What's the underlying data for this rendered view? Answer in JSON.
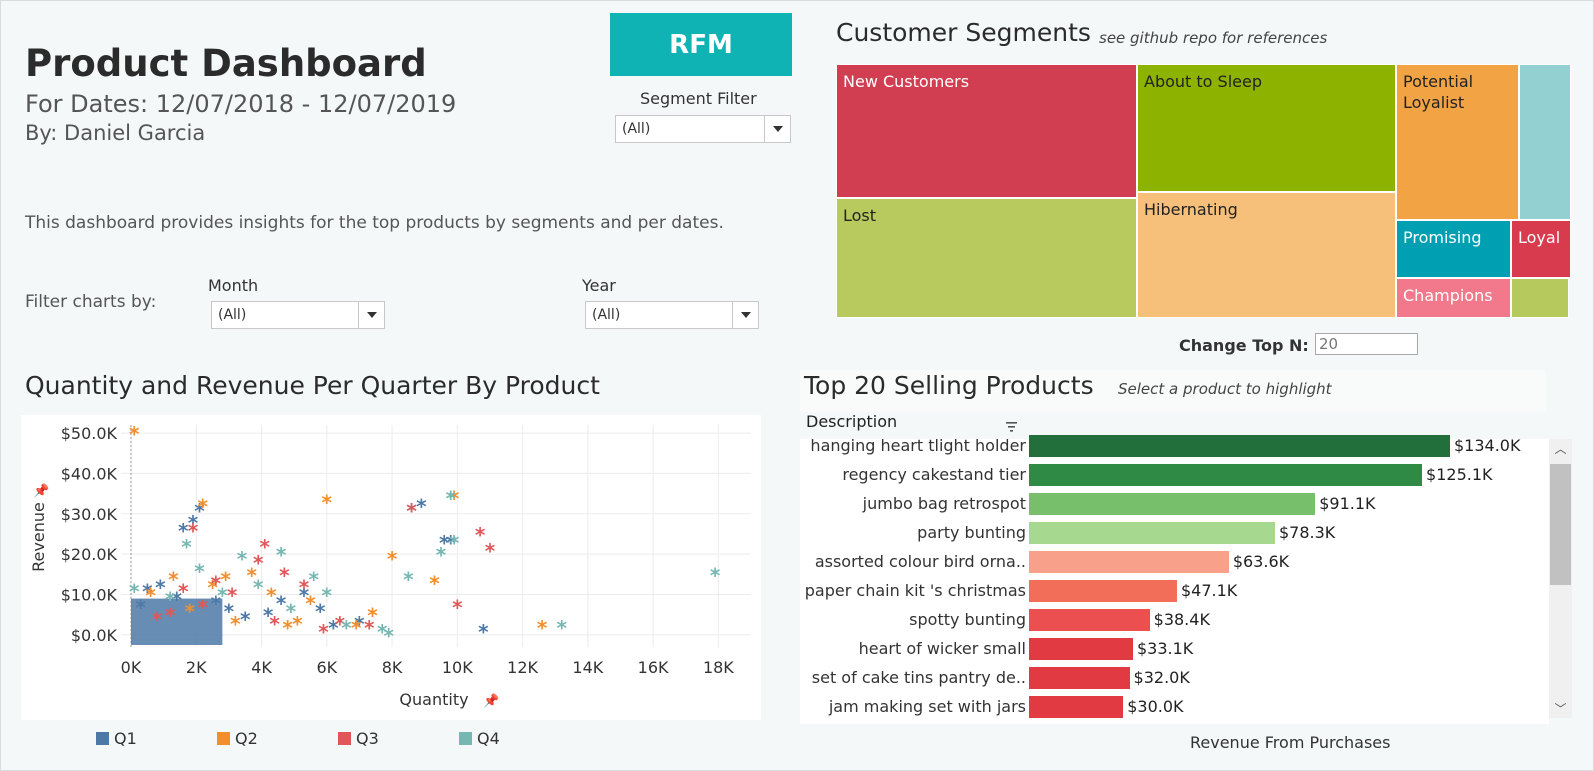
{
  "header": {
    "title": "Product Dashboard",
    "dates": "For Dates: 12/07/2018 - 12/07/2019",
    "author": "By: Daniel Garcia",
    "description": "This dashboard provides insights for the top products by segments and per dates."
  },
  "rfm_button": "RFM",
  "segment_filter": {
    "label": "Segment Filter",
    "value": "(All)"
  },
  "filters": {
    "label": "Filter charts by:",
    "month": {
      "label": "Month",
      "value": "(All)"
    },
    "year": {
      "label": "Year",
      "value": "(All)"
    }
  },
  "segments": {
    "title": "Customer Segments",
    "note": "see github repo for references",
    "tiles": [
      {
        "label": "New Customers",
        "color": "#d13e52"
      },
      {
        "label": "About to Sleep",
        "color": "#8db300"
      },
      {
        "label": "Potential Loyalist",
        "color": "#f2a445"
      },
      {
        "label": "",
        "color": "#93d0d1"
      },
      {
        "label": "Lost",
        "color": "#b8ca5e"
      },
      {
        "label": "Hibernating",
        "color": "#f6c07b"
      },
      {
        "label": "Promising",
        "color": "#00a0b2"
      },
      {
        "label": "Loyal",
        "color": "#d83a4e"
      },
      {
        "label": "Champions",
        "color": "#f2788b"
      },
      {
        "label": "",
        "color": "#b6c95c"
      }
    ]
  },
  "top_n": {
    "label": "Change Top N:",
    "value": "20"
  },
  "scatter": {
    "title": "Quantity and Revenue Per Quarter By Product",
    "xlabel": "Quantity",
    "ylabel": "Revenue",
    "legend": [
      {
        "label": "Q1",
        "color": "#4e79a7"
      },
      {
        "label": "Q2",
        "color": "#f28e2b"
      },
      {
        "label": "Q3",
        "color": "#e15759"
      },
      {
        "label": "Q4",
        "color": "#76b7b2"
      }
    ]
  },
  "bars": {
    "title": "Top 20 Selling Products",
    "note": "Select a product to highlight",
    "column_header": "Description",
    "axis_label": "Revenue From Purchases"
  },
  "chart_data": [
    {
      "type": "scatter",
      "title": "Quantity and Revenue Per Quarter By Product",
      "xlabel": "Quantity",
      "ylabel": "Revenue",
      "xlim": [
        0,
        19000
      ],
      "ylim": [
        -3000,
        52000
      ],
      "xticks": [
        "0K",
        "2K",
        "4K",
        "6K",
        "8K",
        "10K",
        "12K",
        "14K",
        "16K",
        "18K"
      ],
      "yticks": [
        "$0.0K",
        "$10.0K",
        "$20.0K",
        "$30.0K",
        "$40.0K",
        "$50.0K"
      ],
      "grid": true,
      "legend_position": "bottom",
      "series": [
        {
          "name": "Q1",
          "color": "#4e79a7",
          "points": [
            [
              2100,
              31000
            ],
            [
              1900,
              28000
            ],
            [
              1600,
              26000
            ],
            [
              8900,
              32000
            ],
            [
              5300,
              10000
            ],
            [
              4600,
              8000
            ],
            [
              10800,
              1000
            ],
            [
              9600,
              23000
            ],
            [
              8600,
              31000
            ],
            [
              4200,
              5000
            ],
            [
              3500,
              4000
            ],
            [
              3000,
              6000
            ],
            [
              2600,
              8000
            ],
            [
              1400,
              9000
            ],
            [
              900,
              12000
            ],
            [
              500,
              11000
            ],
            [
              300,
              7000
            ],
            [
              7000,
              3000
            ],
            [
              6200,
              2000
            ],
            [
              5800,
              6000
            ],
            [
              9800,
              23000
            ]
          ]
        },
        {
          "name": "Q2",
          "color": "#f28e2b",
          "points": [
            [
              100,
              50000
            ],
            [
              2200,
              32000
            ],
            [
              6000,
              33000
            ],
            [
              9900,
              34000
            ],
            [
              8000,
              19000
            ],
            [
              12600,
              2000
            ],
            [
              9300,
              13000
            ],
            [
              5500,
              8000
            ],
            [
              4300,
              10000
            ],
            [
              2900,
              14000
            ],
            [
              3700,
              15000
            ],
            [
              7400,
              5000
            ],
            [
              6900,
              2000
            ],
            [
              4800,
              2000
            ],
            [
              1300,
              14000
            ],
            [
              600,
              10000
            ],
            [
              1800,
              6000
            ],
            [
              3200,
              3000
            ],
            [
              2500,
              12000
            ],
            [
              5100,
              3000
            ]
          ]
        },
        {
          "name": "Q3",
          "color": "#e15759",
          "points": [
            [
              1900,
              26000
            ],
            [
              4100,
              22000
            ],
            [
              10700,
              25000
            ],
            [
              11000,
              21000
            ],
            [
              10000,
              7000
            ],
            [
              8600,
              31000
            ],
            [
              3900,
              18000
            ],
            [
              4700,
              15000
            ],
            [
              2600,
              13000
            ],
            [
              3100,
              10000
            ],
            [
              1600,
              11000
            ],
            [
              5300,
              12000
            ],
            [
              6400,
              3000
            ],
            [
              5900,
              1000
            ],
            [
              7300,
              2000
            ],
            [
              4400,
              3000
            ],
            [
              2200,
              7000
            ],
            [
              1200,
              5000
            ],
            [
              800,
              4000
            ]
          ]
        },
        {
          "name": "Q4",
          "color": "#76b7b2",
          "points": [
            [
              17900,
              15000
            ],
            [
              9800,
              34000
            ],
            [
              9900,
              23000
            ],
            [
              9500,
              20000
            ],
            [
              8500,
              14000
            ],
            [
              13200,
              2000
            ],
            [
              1700,
              22000
            ],
            [
              2100,
              16000
            ],
            [
              3400,
              19000
            ],
            [
              4600,
              20000
            ],
            [
              5600,
              14000
            ],
            [
              6000,
              10000
            ],
            [
              7900,
              0
            ],
            [
              7700,
              1000
            ],
            [
              2800,
              10000
            ],
            [
              100,
              11000
            ],
            [
              1200,
              9000
            ],
            [
              3900,
              12000
            ],
            [
              4900,
              6000
            ],
            [
              6600,
              2000
            ]
          ]
        }
      ]
    },
    {
      "type": "bar",
      "orientation": "horizontal",
      "title": "Top 20 Selling Products",
      "xlabel": "Revenue From Purchases",
      "categories": [
        "hanging heart tlight holder",
        "regency cakestand  tier",
        "jumbo bag  retrospot",
        "party bunting",
        "assorted colour bird orna..",
        "paper chain kit 's christmas",
        "spotty bunting",
        "heart of wicker small",
        "set of  cake tins pantry de..",
        "jam making set with jars"
      ],
      "values": [
        134000,
        125100,
        91100,
        78300,
        63600,
        47100,
        38400,
        33100,
        32000,
        30000
      ],
      "value_labels": [
        "$134.0K",
        "$125.1K",
        "$91.1K",
        "$78.3K",
        "$63.6K",
        "$47.1K",
        "$38.4K",
        "$33.1K",
        "$32.0K",
        "$30.0K"
      ],
      "colors": [
        "#226f3c",
        "#2f8a46",
        "#77bf6b",
        "#a7d890",
        "#f9a08a",
        "#f26e58",
        "#ec4f4f",
        "#e23a42",
        "#e23a42",
        "#e23a42"
      ]
    }
  ]
}
